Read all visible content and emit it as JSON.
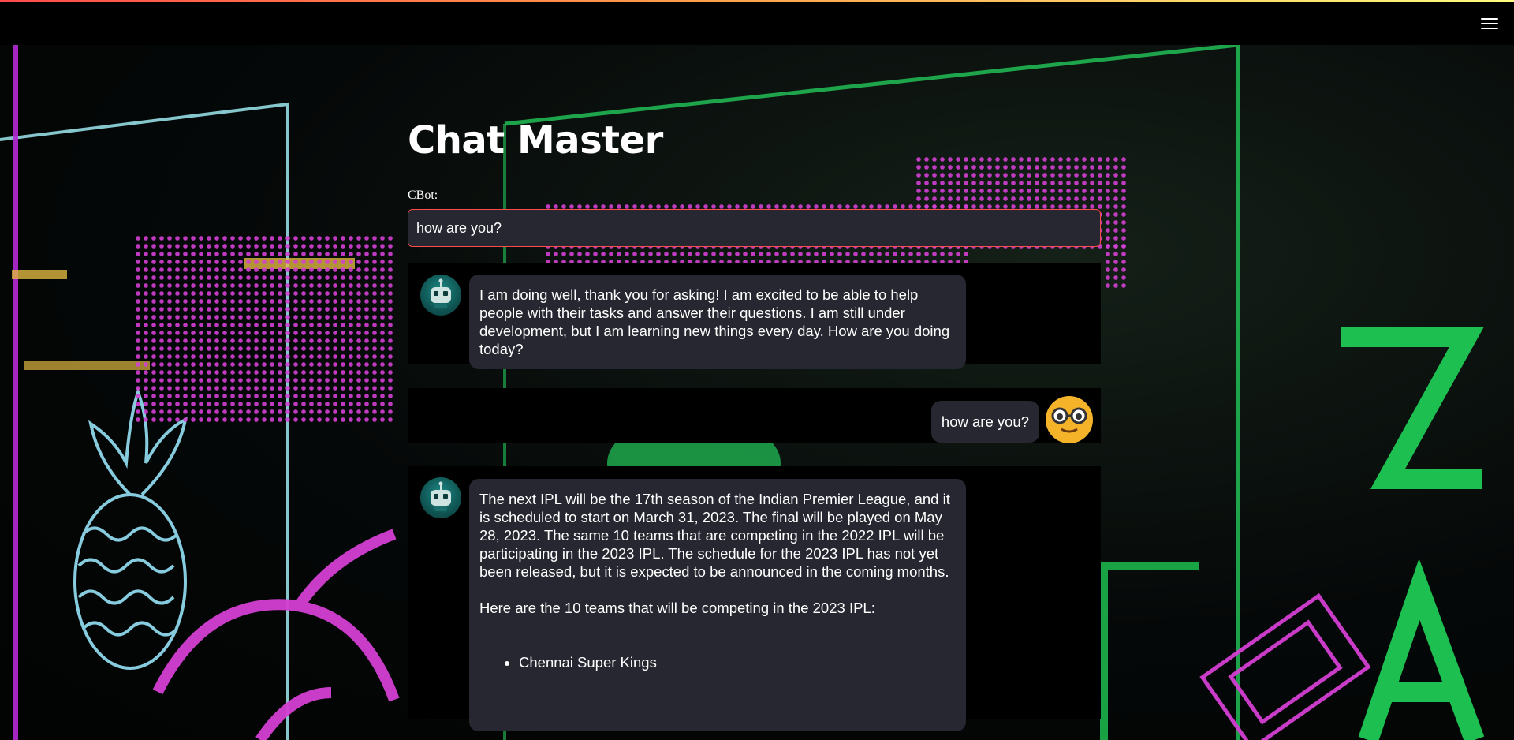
{
  "app": {
    "title": "Chat Master",
    "input_label": "CBot:",
    "input_value": "how are you?"
  },
  "messages": [
    {
      "role": "bot",
      "avatar_icon": "robot-icon",
      "text": "I am doing well, thank you for asking! I am excited to be able to help people with their tasks and answer their questions. I am still under development, but I am learning new things every day. How are you doing today?"
    },
    {
      "role": "user",
      "avatar_icon": "nerd-face-icon",
      "text": "how are you?"
    },
    {
      "role": "bot",
      "avatar_icon": "robot-icon",
      "paragraph1": "The next IPL will be the 17th season of the Indian Premier League, and it is scheduled to start on March 31, 2023. The final will be played on May 28, 2023. The same 10 teams that are competing in the 2022 IPL will be participating in the 2023 IPL. The schedule for the 2023 IPL has not yet been released, but it is expected to be announced in the coming months.",
      "paragraph2": "Here are the 10 teams that will be competing in the 2023 IPL:",
      "list": [
        "Chennai Super Kings"
      ]
    }
  ],
  "colors": {
    "accent": "#ff4b4b",
    "bubble_bg": "#262730",
    "user_avatar": "#f5b32a"
  }
}
